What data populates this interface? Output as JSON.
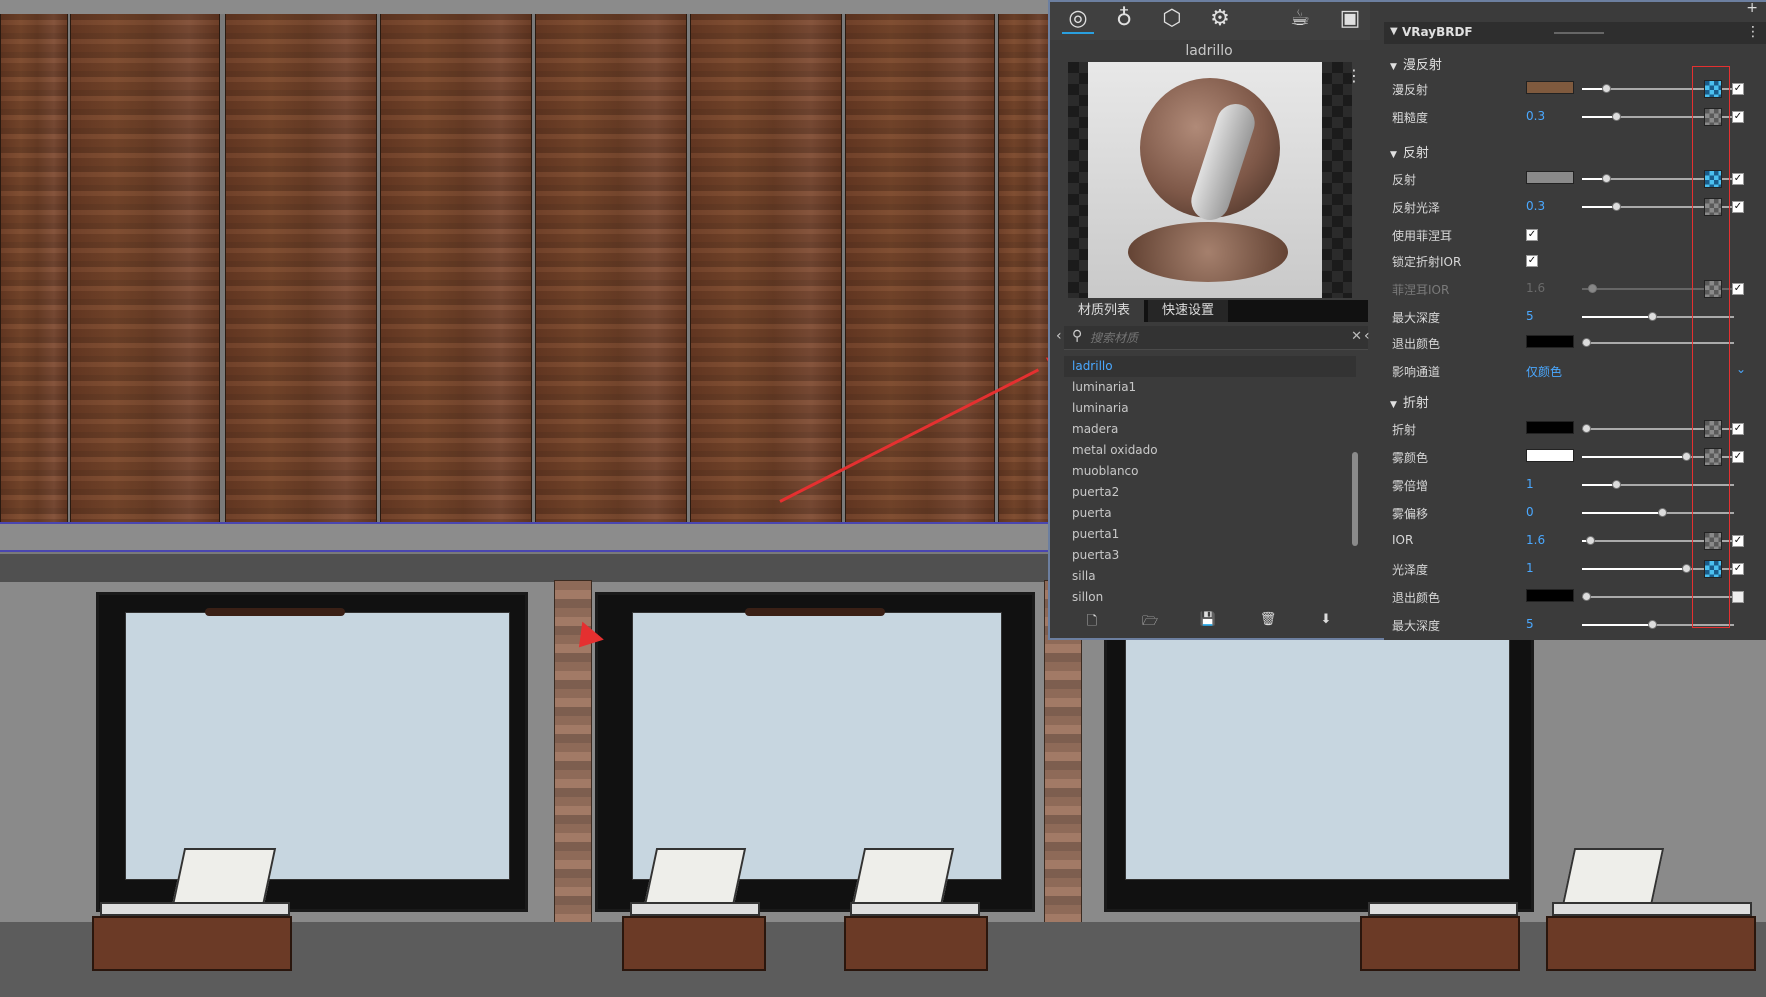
{
  "editor": {
    "material_name": "ladrillo",
    "tabs": [
      "材质列表",
      "快速设置"
    ],
    "search_placeholder": "搜索材质",
    "materials": [
      "ladrillo",
      "luminaria1",
      "luminaria",
      "madera",
      "metal oxidado",
      "muoblanco",
      "puerta2",
      "puerta",
      "puerta1",
      "puerta3",
      "silla",
      "sillon"
    ],
    "selected_material": "ladrillo",
    "toolbar_icons": [
      "material-icon",
      "light-icon",
      "geometry-icon",
      "settings-icon",
      "teapot-icon",
      "render-window-icon"
    ],
    "bottom_icons": [
      "new-file-icon",
      "open-folder-icon",
      "save-icon",
      "delete-icon",
      "import-icon"
    ]
  },
  "props": {
    "header_title": "VRayBRDF",
    "sections": {
      "diffuse": "漫反射",
      "reflection": "反射",
      "refraction": "折射"
    },
    "rows": {
      "diffuse": {
        "label": "漫反射",
        "color": "#7f5a3e"
      },
      "roughness": {
        "label": "粗糙度",
        "value": "0.3"
      },
      "reflect": {
        "label": "反射",
        "color": "#8a8a8a"
      },
      "reflect_gloss": {
        "label": "反射光泽",
        "value": "0.3"
      },
      "use_fresnel": {
        "label": "使用菲涅耳"
      },
      "lock_ior": {
        "label": "锁定折射IOR"
      },
      "fresnel_ior": {
        "label": "菲涅耳IOR",
        "value": "1.6"
      },
      "max_depth": {
        "label": "最大深度",
        "value": "5"
      },
      "exit_color": {
        "label": "退出颜色",
        "color": "#000000"
      },
      "affect_channels": {
        "label": "影响通道",
        "value": "仅颜色"
      },
      "refract": {
        "label": "折射",
        "color": "#000000"
      },
      "fog_color": {
        "label": "雾颜色",
        "color": "#ffffff"
      },
      "fog_mult": {
        "label": "雾倍增",
        "value": "1"
      },
      "fog_bias": {
        "label": "雾偏移",
        "value": "0"
      },
      "ior": {
        "label": "IOR",
        "value": "1.6"
      },
      "gloss": {
        "label": "光泽度",
        "value": "1"
      },
      "exit_color2": {
        "label": "退出颜色",
        "color": "#000000"
      },
      "max_depth2": {
        "label": "最大深度",
        "value": "5"
      }
    }
  },
  "colors": {
    "accent": "#4aa8ff",
    "annotation": "#e53030"
  }
}
